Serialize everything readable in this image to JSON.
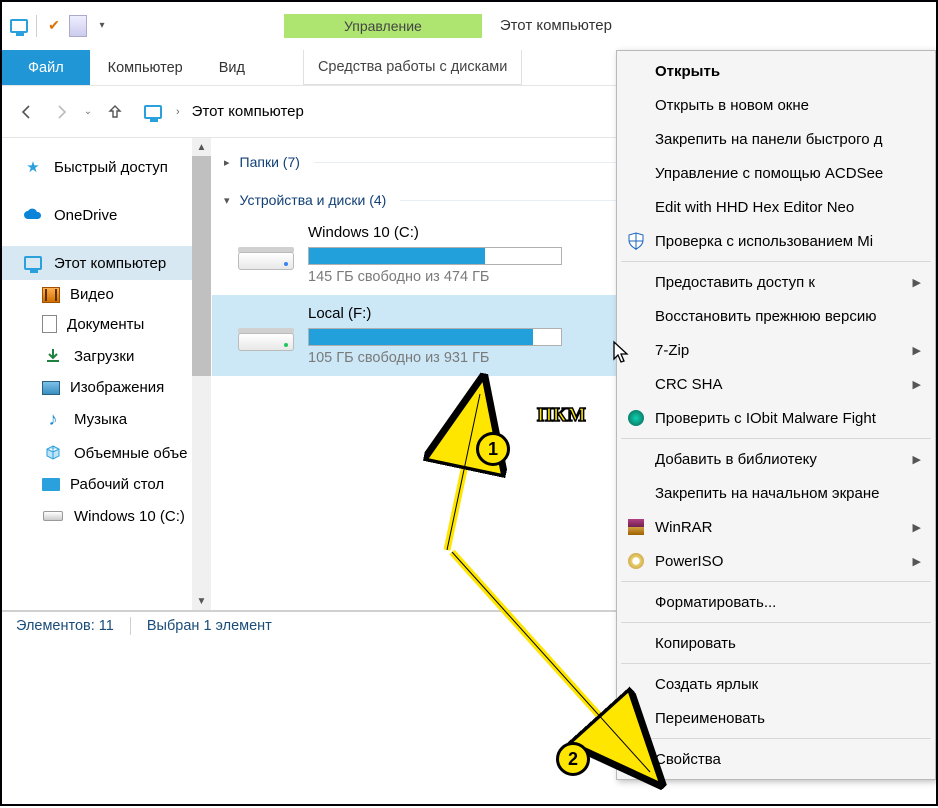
{
  "window": {
    "title": "Этот компьютер",
    "manage_tab": "Управление"
  },
  "ribbon": {
    "file": "Файл",
    "computer": "Компьютер",
    "view": "Вид",
    "drive_tools": "Средства работы с дисками"
  },
  "address": {
    "location": "Этот компьютер"
  },
  "sidebar": {
    "quick_access": "Быстрый доступ",
    "onedrive": "OneDrive",
    "this_pc": "Этот компьютер",
    "video": "Видео",
    "documents": "Документы",
    "downloads": "Загрузки",
    "pictures": "Изображения",
    "music": "Музыка",
    "volumes": "Объемные объе",
    "desktop": "Рабочий стол",
    "c_drive": "Windows 10 (C:)"
  },
  "groups": {
    "folders": "Папки (7)",
    "devices": "Устройства и диски (4)"
  },
  "drives": {
    "c": {
      "name": "Windows 10 (C:)",
      "free": "145 ГБ свободно из 474 ГБ",
      "fill_pct": 70
    },
    "f": {
      "name": "Local (F:)",
      "free": "105 ГБ свободно из 931 ГБ",
      "fill_pct": 89
    }
  },
  "statusbar": {
    "count": "Элементов: 11",
    "selected": "Выбран 1 элемент"
  },
  "context_menu": {
    "open": "Открыть",
    "open_new": "Открыть в новом окне",
    "pin_quick": "Закрепить на панели быстрого д",
    "acdsee": "Управление с помощью ACDSee",
    "hex": "Edit with HHD Hex Editor Neo",
    "defender": "Проверка с использованием Mi",
    "share": "Предоставить доступ к",
    "restore": "Восстановить прежнюю версию",
    "sevenzip": "7-Zip",
    "crcsha": "CRC SHA",
    "iobit": "Проверить с IObit Malware Fight",
    "add_lib": "Добавить в библиотеку",
    "pin_start": "Закрепить на начальном экране",
    "winrar": "WinRAR",
    "poweriso": "PowerISO",
    "format": "Форматировать...",
    "copy": "Копировать",
    "shortcut": "Создать ярлык",
    "rename": "Переименовать",
    "properties": "Свойства"
  },
  "annotations": {
    "m1": "1",
    "m2": "2",
    "rmb_label": "ПКМ"
  }
}
